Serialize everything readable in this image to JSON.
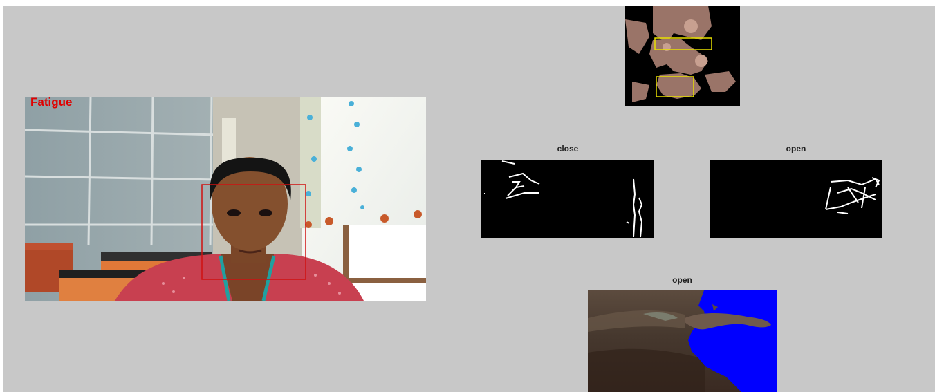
{
  "camera_panel": {
    "status_text": "Fatigue",
    "status_color": "#e00000",
    "face_box_color": "#d01010"
  },
  "face_mask_panel": {
    "title": "",
    "eye_region_color": "#e8e000",
    "mouth_region_color": "#e8e000"
  },
  "eye_close_panel": {
    "title": "close"
  },
  "eye_open_panel": {
    "title": "open"
  },
  "mouth_panel": {
    "title": "open",
    "mask_color": "#0000ff"
  }
}
